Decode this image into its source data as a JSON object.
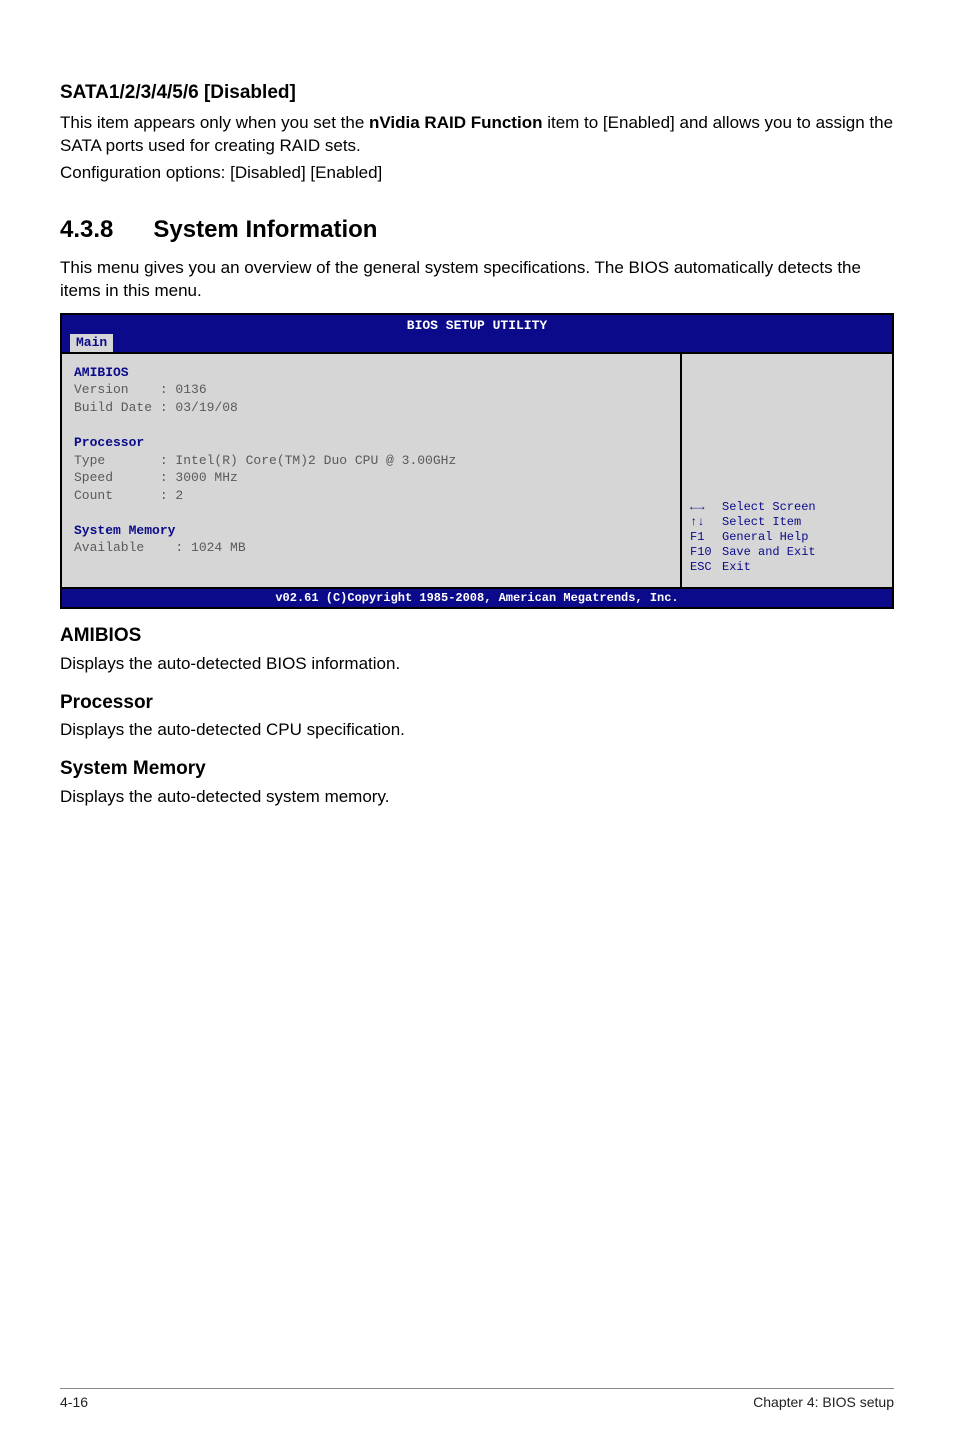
{
  "sata": {
    "title": "SATA1/2/3/4/5/6 [Disabled]",
    "line1_pre": "This item appears only when you set the ",
    "line1_bold": "nVidia RAID Function",
    "line1_post": " item to [Enabled] and allows you to assign the SATA ports used for creating RAID sets.",
    "line3": "Configuration options: [Disabled] [Enabled]"
  },
  "section": {
    "number": "4.3.8",
    "title": "System Information",
    "desc": "This menu gives you an overview of the general system specifications. The BIOS automatically detects the items in this menu."
  },
  "bios": {
    "title": "BIOS SETUP UTILITY",
    "tab": "Main",
    "amibios_heading": "AMIBIOS",
    "version_line": "Version    : 0136",
    "build_line": "Build Date : 03/19/08",
    "processor_heading": "Processor",
    "type_line": "Type       : Intel(R) Core(TM)2 Duo CPU @ 3.00GHz",
    "speed_line": "Speed      : 3000 MHz",
    "count_line": "Count      : 2",
    "sysmem_heading": "System Memory",
    "avail_line": "Available    : 1024 MB",
    "help": {
      "r1_key": "←→",
      "r1_txt": "Select Screen",
      "r2_key": "↑↓",
      "r2_txt": "Select Item",
      "r3_key": "F1",
      "r3_txt": "General Help",
      "r4_key": "F10",
      "r4_txt": "Save and Exit",
      "r5_key": "ESC",
      "r5_txt": "Exit"
    },
    "footer": "v02.61 (C)Copyright 1985-2008, American Megatrends, Inc."
  },
  "subs": {
    "amibios_t": "AMIBIOS",
    "amibios_d": "Displays the auto-detected BIOS information.",
    "proc_t": "Processor",
    "proc_d": "Displays the auto-detected CPU specification.",
    "sysmem_t": "System Memory",
    "sysmem_d": "Displays the auto-detected system memory."
  },
  "footer": {
    "left": "4-16",
    "right": "Chapter 4: BIOS setup"
  }
}
